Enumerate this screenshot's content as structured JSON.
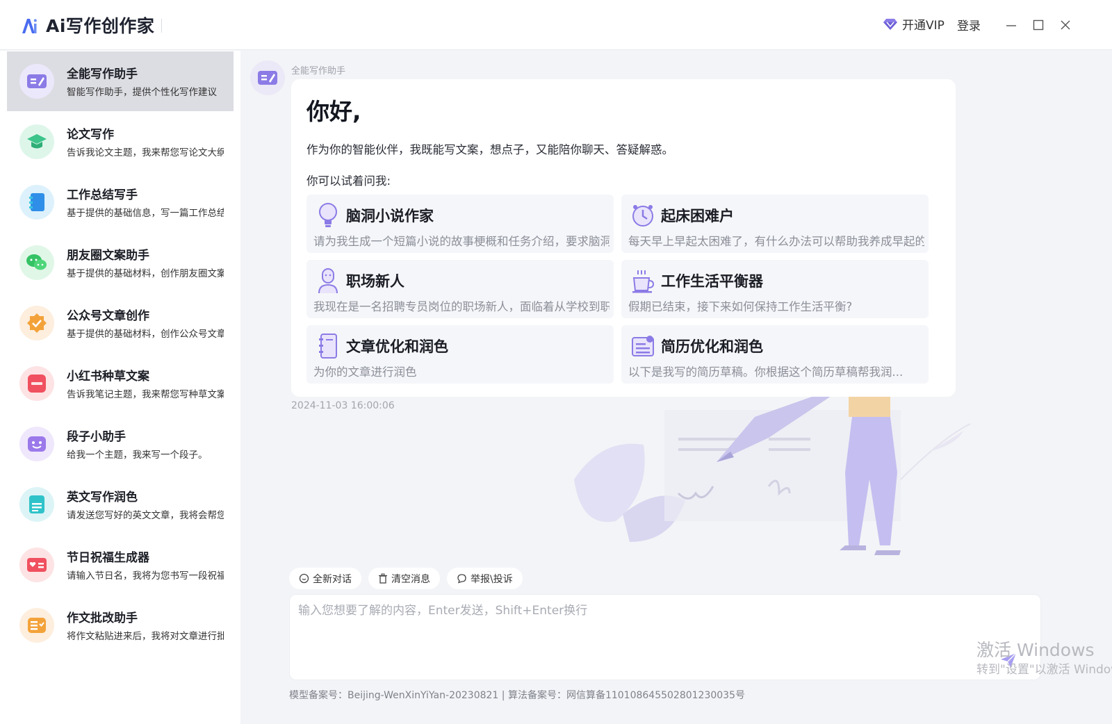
{
  "app": {
    "title": "Ai写作创作家",
    "vip_label": "开通VIP",
    "login_label": "登录",
    "accent_color": "#7b6fd8"
  },
  "window_controls": [
    "minimize-icon",
    "maximize-icon",
    "close-icon"
  ],
  "sidebar": {
    "items": [
      {
        "title": "全能写作助手",
        "desc": "智能写作助手，提供个性化写作建议",
        "icon": "edit-card-icon",
        "color": "#8b7be6",
        "bg": "#ece8fb",
        "active": true
      },
      {
        "title": "论文写作",
        "desc": "告诉我论文主题，我来帮您写论文大纲",
        "icon": "graduation-cap-icon",
        "color": "#3cc48a",
        "bg": "#def6ea",
        "active": false
      },
      {
        "title": "工作总结写手",
        "desc": "基于提供的基础信息，写一篇工作总结",
        "icon": "notebook-icon",
        "color": "#2f8fe8",
        "bg": "#dcf1fb",
        "active": false
      },
      {
        "title": "朋友圈文案助手",
        "desc": "基于提供的基础材料，创作朋友圈文案",
        "icon": "wechat-icon",
        "color": "#35c265",
        "bg": "#e0f7e7",
        "active": false
      },
      {
        "title": "公众号文章创作",
        "desc": "基于提供的基础材料，创作公众号文章",
        "icon": "verified-badge-icon",
        "color": "#f3a23a",
        "bg": "#fdeedd",
        "active": false
      },
      {
        "title": "小红书种草文案",
        "desc": "告诉我笔记主题，我来帮您写种草文案",
        "icon": "xiaohongshu-icon",
        "color": "#f0505f",
        "bg": "#fde3e4",
        "active": false
      },
      {
        "title": "段子小助手",
        "desc": "给我一个主题，我来写一个段子。",
        "icon": "smile-face-icon",
        "color": "#9b79ea",
        "bg": "#efe7fc",
        "active": false
      },
      {
        "title": "英文写作润色",
        "desc": "请发送您写好的英文文章，我将会帮您润色",
        "icon": "english-doc-icon",
        "color": "#2fc3c9",
        "bg": "#dcf4f6",
        "active": false
      },
      {
        "title": "节日祝福生成器",
        "desc": "请输入节日名，我将为您书写一段祝福",
        "icon": "greeting-card-icon",
        "color": "#f0505f",
        "bg": "#fde3e4",
        "active": false
      },
      {
        "title": "作文批改助手",
        "desc": "将作文粘贴进来后，我将对文章进行批改",
        "icon": "checklist-icon",
        "color": "#f3a23a",
        "bg": "#fdeedd",
        "active": false
      }
    ]
  },
  "chat": {
    "bot_name": "全能写作助手",
    "greeting": "你好,",
    "intro": "作为你的智能伙伴，我既能写文案，想点子，又能陪你聊天、答疑解惑。",
    "try_label": "你可以试着问我:",
    "timestamp": "2024-11-03 16:00:06",
    "suggestions": [
      {
        "title": "脑洞小说作家",
        "desc": "请为我生成一个短篇小说的故事梗概和任务介绍，要求脑洞大开",
        "icon": "lightbulb-icon"
      },
      {
        "title": "起床困难户",
        "desc": "每天早上早起太困难了，有什么办法可以帮助我养成早起的习惯",
        "icon": "alarm-clock-icon"
      },
      {
        "title": "职场新人",
        "desc": "我现在是一名招聘专员岗位的职场新人，面临着从学校到职场的转变",
        "icon": "person-icon"
      },
      {
        "title": "工作生活平衡器",
        "desc": "假期已结束，接下来如何保持工作生活平衡?",
        "icon": "coffee-cup-icon"
      },
      {
        "title": "文章优化和润色",
        "desc": "为你的文章进行润色",
        "icon": "notebook-icon"
      },
      {
        "title": "简历优化和润色",
        "desc": "以下是我写的简历草稿。你根据这个简历草稿帮我润...",
        "icon": "resume-icon"
      }
    ]
  },
  "actions": {
    "new_chat": "全新对话",
    "clear": "清空消息",
    "report": "举报\\投诉"
  },
  "input": {
    "placeholder": "输入您想要了解的内容，Enter发送，Shift+Enter换行",
    "value": ""
  },
  "watermark": {
    "line1": "激活 Windows",
    "line2": "转到\"设置\"以激活 Windows。"
  },
  "footer": {
    "text": "模型备案号：Beijing-WenXinYiYan-20230821  |  算法备案号：网信算备110108645502801230035号"
  }
}
